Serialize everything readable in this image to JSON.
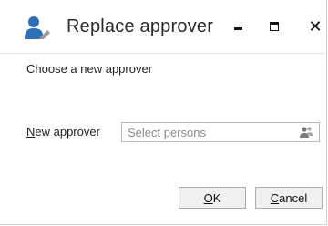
{
  "window": {
    "title": "Replace approver",
    "icon": "user-edit-icon",
    "controls": [
      "minimize-icon",
      "maximize-icon",
      "close-icon"
    ]
  },
  "dialog": {
    "subtitle": "Choose a new approver",
    "new_approver": {
      "label_accel": "N",
      "label_rest": "ew approver",
      "placeholder": "Select persons",
      "value": "",
      "picker_icon": "address-book-icon"
    },
    "buttons": {
      "ok_accel": "O",
      "ok_rest": "K",
      "cancel_accel": "C",
      "cancel_rest": "ancel"
    }
  }
}
